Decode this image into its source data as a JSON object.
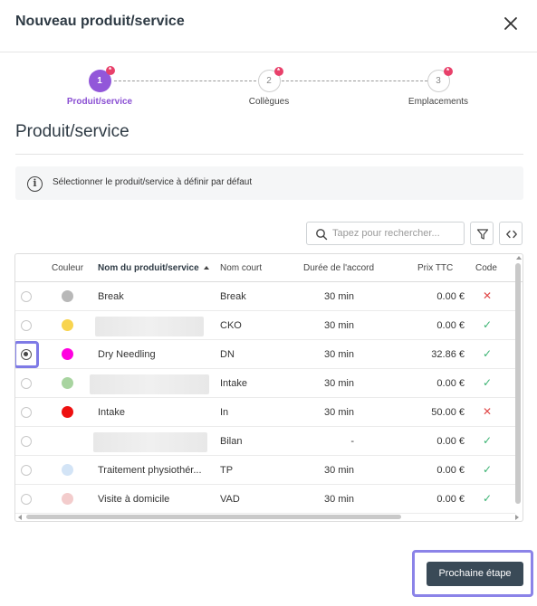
{
  "header": {
    "title": "Nouveau produit/service"
  },
  "stepper": {
    "steps": [
      {
        "number": "1",
        "label": "Produit/service",
        "active": true
      },
      {
        "number": "2",
        "label": "Collègues",
        "active": false
      },
      {
        "number": "3",
        "label": "Emplacements",
        "active": false
      }
    ],
    "required_marker": "*"
  },
  "section": {
    "title": "Produit/service"
  },
  "info": {
    "text": "Sélectionner le produit/service à définir par défaut",
    "icon": "i"
  },
  "search": {
    "placeholder": "Tapez pour rechercher..."
  },
  "table": {
    "columns": {
      "color": "Couleur",
      "name": "Nom du produit/service",
      "short": "Nom court",
      "duration": "Durée de l'accord",
      "price": "Prix TTC",
      "code": "Code"
    },
    "sorted_column": "name",
    "sort_direction": "ascending",
    "rows": [
      {
        "selected": false,
        "color": "#b8b8b8",
        "name": "Break",
        "short": "Break",
        "duration": "30 min",
        "price": "0.00 €",
        "code": "✕",
        "code_state": "no"
      },
      {
        "selected": false,
        "color": "#f8d44f",
        "name": "",
        "short": "CKO",
        "duration": "30 min",
        "price": "0.00 €",
        "code": "✓",
        "code_state": "yes"
      },
      {
        "selected": true,
        "color": "#ff00e0",
        "name": "Dry Needling",
        "short": "DN",
        "duration": "30 min",
        "price": "32.86 €",
        "code": "✓",
        "code_state": "yes"
      },
      {
        "selected": false,
        "color": "#a8d4a0",
        "name": "",
        "short": "Intake",
        "duration": "30 min",
        "price": "0.00 €",
        "code": "✓",
        "code_state": "yes"
      },
      {
        "selected": false,
        "color": "#ee1010",
        "name": "Intake",
        "short": "In",
        "duration": "30 min",
        "price": "50.00 €",
        "code": "✕",
        "code_state": "no"
      },
      {
        "selected": false,
        "color": "",
        "name": "",
        "short": "Bilan",
        "duration": "-",
        "price": "0.00 €",
        "code": "✓",
        "code_state": "yes"
      },
      {
        "selected": false,
        "color": "#d3e4f6",
        "name": "Traitement physiothér...",
        "short": "TP",
        "duration": "30 min",
        "price": "0.00 €",
        "code": "✓",
        "code_state": "yes"
      },
      {
        "selected": false,
        "color": "#f3cccc",
        "name": "Visite à domicile",
        "short": "VAD",
        "duration": "30 min",
        "price": "0.00 €",
        "code": "✓",
        "code_state": "yes"
      }
    ]
  },
  "footer": {
    "next_label": "Prochaine étape"
  },
  "colors": {
    "accent": "#9257d9",
    "required": "#e8406a",
    "check_yes": "#3bb372",
    "check_no": "#e04848",
    "primary_button": "#3a4a57",
    "highlight": "#8b83e8"
  }
}
